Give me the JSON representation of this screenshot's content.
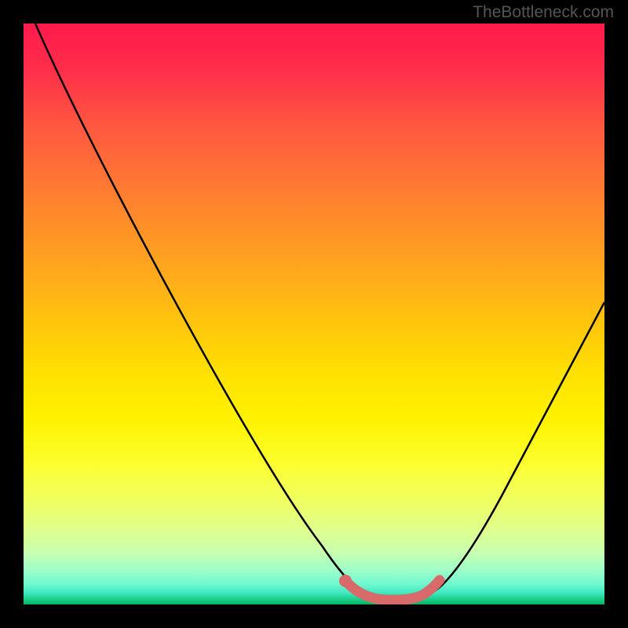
{
  "watermark": "TheBottleneck.com",
  "chart_data": {
    "type": "line",
    "title": "",
    "xlabel": "",
    "ylabel": "",
    "xlim": [
      0,
      100
    ],
    "ylim": [
      0,
      100
    ],
    "series": [
      {
        "name": "bottleneck-curve",
        "color": "#000000",
        "x": [
          2,
          10,
          20,
          30,
          40,
          48,
          53,
          56,
          60,
          64,
          68,
          74,
          82,
          90,
          100
        ],
        "y": [
          100,
          85,
          67,
          49,
          31,
          16,
          7,
          3,
          1,
          0,
          0,
          3,
          14,
          30,
          52
        ]
      },
      {
        "name": "optimal-range-highlight",
        "color": "#d96a6a",
        "x": [
          55,
          58,
          62,
          66,
          68,
          70
        ],
        "y": [
          3.5,
          1.5,
          0.5,
          0.5,
          1,
          3
        ]
      }
    ],
    "markers": [
      {
        "name": "optimal-point",
        "x": 55,
        "y": 3.5,
        "color": "#d96a6a"
      }
    ],
    "gradient_background": {
      "type": "vertical",
      "stops": [
        {
          "pos": 0,
          "color": "#ff1a4c"
        },
        {
          "pos": 50,
          "color": "#ffe000"
        },
        {
          "pos": 85,
          "color": "#e8ff80"
        },
        {
          "pos": 100,
          "color": "#00b860"
        }
      ]
    }
  }
}
